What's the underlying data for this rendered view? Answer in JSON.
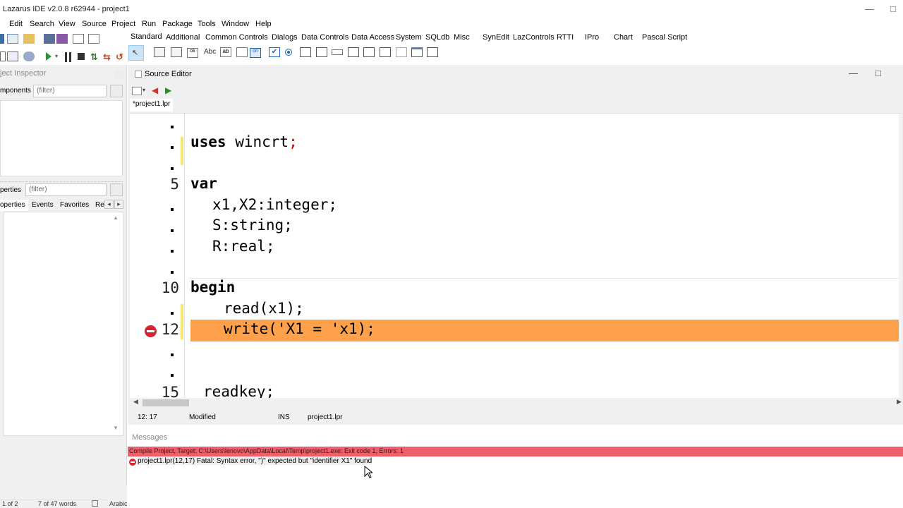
{
  "window": {
    "title": "Lazarus IDE v2.0.8 r62944 - project1",
    "min_icon": "minimize-icon",
    "restore_icon": "restore-icon"
  },
  "menu": [
    "Edit",
    "Search",
    "View",
    "Source",
    "Project",
    "Run",
    "Package",
    "Tools",
    "Window",
    "Help"
  ],
  "palette_tabs": [
    "Standard",
    "Additional",
    "Common Controls",
    "Dialogs",
    "Data Controls",
    "Data Access",
    "System",
    "SQLdb",
    "Misc",
    "SynEdit",
    "LazControls",
    "RTTI",
    "IPro",
    "Chart",
    "Pascal Script"
  ],
  "object_inspector": {
    "title": "ject Inspector",
    "components_label": "mponents",
    "components_filter": "(filter)",
    "properties_label": "perties",
    "properties_filter": "(filter)",
    "tabs": [
      "operties",
      "Events",
      "Favorites",
      "Re"
    ]
  },
  "source_editor": {
    "title": "Source Editor",
    "file_tab": "*project1.lpr",
    "lines": [
      {
        "num": "",
        "code_kw": "",
        "code": ""
      },
      {
        "num": "",
        "code_kw": "uses",
        "code": " wincrt",
        "sym": ";"
      },
      {
        "num": "",
        "code_kw": "",
        "code": ""
      },
      {
        "num": "5",
        "code_kw": "var",
        "code": ""
      },
      {
        "num": "",
        "indent": "  ",
        "code": "x1,X2:integer;"
      },
      {
        "num": "",
        "indent": "  ",
        "code": "S:string;"
      },
      {
        "num": "",
        "indent": "  ",
        "code": "R:real;"
      },
      {
        "num": "",
        "code_kw": "",
        "code": ""
      },
      {
        "num": "10",
        "code_kw": "begin",
        "code": ""
      },
      {
        "num": "",
        "indent": "   ",
        "code": "read(x1);"
      },
      {
        "num": "12",
        "indent": "   ",
        "code": "write('X1 = 'x1);",
        "error": true
      },
      {
        "num": "",
        "code_kw": "",
        "code": ""
      },
      {
        "num": "",
        "code_kw": "",
        "code": ""
      },
      {
        "num": "15",
        "indent": " ",
        "code": "readkey;"
      }
    ],
    "status": {
      "position": "12: 17",
      "modified": "Modified",
      "mode": "INS",
      "file": "project1.lpr"
    }
  },
  "messages": {
    "title": "Messages",
    "summary": "Compile Project, Target: C:\\Users\\lenovo\\AppData\\Local\\Temp\\project1.exe: Exit code 1, Errors: 1",
    "error": "project1.lpr(12,17) Fatal: Syntax error, \")\" expected but \"identifier X1\" found"
  },
  "taskbar": {
    "page": "1 of 2",
    "words": "7 of 47 words",
    "lang": "Arabic"
  },
  "colors": {
    "error_line": "#ffa04a",
    "error_banner": "#f05e6a",
    "modified_marker": "#f2e66b"
  }
}
